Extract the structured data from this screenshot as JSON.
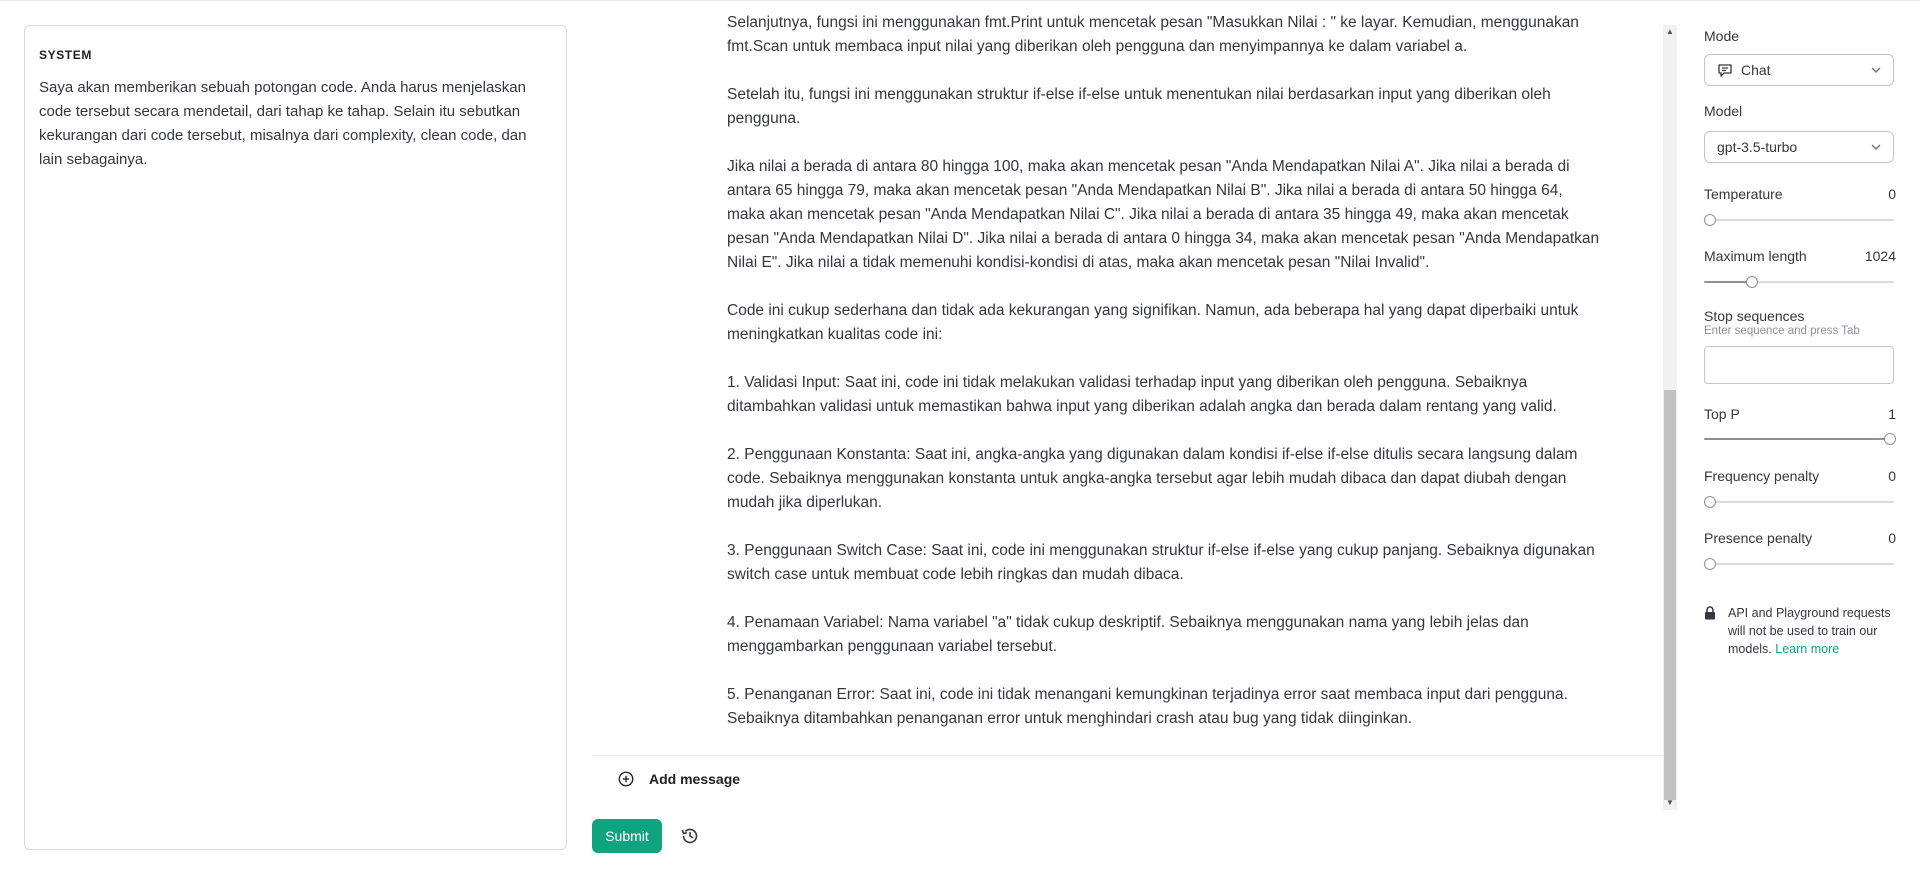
{
  "system": {
    "label": "SYSTEM",
    "text": "Saya akan memberikan sebuah potongan code. Anda harus menjelaskan code tersebut secara mendetail, dari tahap ke tahap. Selain itu sebutkan kekurangan dari code tersebut, misalnya dari complexity, clean code, dan lain sebagainya."
  },
  "messages": {
    "assistant_paragraphs": [
      "Selanjutnya, fungsi ini menggunakan fmt.Print untuk mencetak pesan \"Masukkan Nilai : \" ke layar. Kemudian, menggunakan fmt.Scan untuk membaca input nilai yang diberikan oleh pengguna dan menyimpannya ke dalam variabel a.",
      "Setelah itu, fungsi ini menggunakan struktur if-else if-else untuk menentukan nilai berdasarkan input yang diberikan oleh pengguna.",
      "Jika nilai a berada di antara 80 hingga 100, maka akan mencetak pesan \"Anda Mendapatkan Nilai A\". Jika nilai a berada di antara 65 hingga 79, maka akan mencetak pesan \"Anda Mendapatkan Nilai B\". Jika nilai a berada di antara 50 hingga 64, maka akan mencetak pesan \"Anda Mendapatkan Nilai C\". Jika nilai a berada di antara 35 hingga 49, maka akan mencetak pesan \"Anda Mendapatkan Nilai D\". Jika nilai a berada di antara 0 hingga 34, maka akan mencetak pesan \"Anda Mendapatkan Nilai E\". Jika nilai a tidak memenuhi kondisi-kondisi di atas, maka akan mencetak pesan \"Nilai Invalid\".",
      "Code ini cukup sederhana dan tidak ada kekurangan yang signifikan. Namun, ada beberapa hal yang dapat diperbaiki untuk meningkatkan kualitas code ini:",
      "1. Validasi Input: Saat ini, code ini tidak melakukan validasi terhadap input yang diberikan oleh pengguna. Sebaiknya ditambahkan validasi untuk memastikan bahwa input yang diberikan adalah angka dan berada dalam rentang yang valid.",
      "2. Penggunaan Konstanta: Saat ini, angka-angka yang digunakan dalam kondisi if-else if-else ditulis secara langsung dalam code. Sebaiknya menggunakan konstanta untuk angka-angka tersebut agar lebih mudah dibaca dan dapat diubah dengan mudah jika diperlukan.",
      "3. Penggunaan Switch Case: Saat ini, code ini menggunakan struktur if-else if-else yang cukup panjang. Sebaiknya digunakan switch case untuk membuat code lebih ringkas dan mudah dibaca.",
      "4. Penamaan Variabel: Nama variabel \"a\" tidak cukup deskriptif. Sebaiknya menggunakan nama yang lebih jelas dan menggambarkan penggunaan variabel tersebut.",
      "5. Penanganan Error: Saat ini, code ini tidak menangani kemungkinan terjadinya error saat membaca input dari pengguna. Sebaiknya ditambahkan penanganan error untuk menghindari crash atau bug yang tidak diinginkan."
    ],
    "add_message_label": "Add message",
    "add_icon": "plus-circle-icon"
  },
  "actions": {
    "submit_label": "Submit",
    "history_icon": "history-icon"
  },
  "settings": {
    "mode": {
      "label": "Mode",
      "value": "Chat",
      "icon": "chat-icon"
    },
    "model": {
      "label": "Model",
      "value": "gpt-3.5-turbo"
    },
    "temperature": {
      "label": "Temperature",
      "value": "0",
      "fraction": 0.0
    },
    "maximum_length": {
      "label": "Maximum length",
      "value": "1024",
      "fraction": 0.25
    },
    "stop_sequences": {
      "label": "Stop sequences",
      "hint": "Enter sequence and press Tab",
      "value": ""
    },
    "top_p": {
      "label": "Top P",
      "value": "1",
      "fraction": 1.0
    },
    "frequency_penalty": {
      "label": "Frequency penalty",
      "value": "0",
      "fraction": 0.0
    },
    "presence_penalty": {
      "label": "Presence penalty",
      "value": "0",
      "fraction": 0.0
    },
    "notice": {
      "text": "API and Playground requests will not be used to train our models.",
      "link": "Learn more",
      "icon": "lock-icon"
    }
  },
  "colors": {
    "accent": "#10a37f",
    "border": "#d9d9e3",
    "text": "#353740"
  }
}
